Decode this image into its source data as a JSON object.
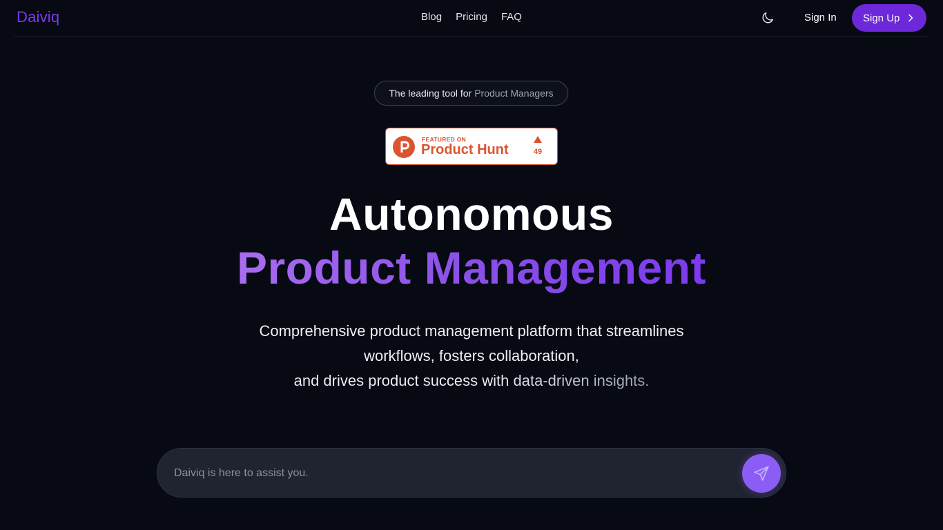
{
  "header": {
    "logo": "Daiviq",
    "nav": [
      "Blog",
      "Pricing",
      "FAQ"
    ],
    "theme_toggle_icon": "moon-icon",
    "sign_in": "Sign In",
    "sign_up": "Sign Up",
    "sign_up_icon": "chevron-right-icon"
  },
  "hero": {
    "pill_text_1": "The leading tool for",
    "pill_text_2": "Product Managers",
    "badge": {
      "featured": "FEATURED ON",
      "name": "Product Hunt",
      "logo_letter": "P",
      "upvotes": "49",
      "brand_color": "#DA552F"
    },
    "title_line1": "Autonomous",
    "title_line2": "Product Management",
    "subtitle_line1": "Comprehensive product management platform that streamlines",
    "subtitle_line2": "workflows, fosters collaboration,",
    "subtitle_line3": "and drives product success with data-driven insights."
  },
  "chat": {
    "placeholder": "Daiviq is here to assist you.",
    "send_icon": "send-icon"
  },
  "colors": {
    "background": "#070913",
    "accent": "#7C3AED",
    "button": "#6D28D9",
    "send_button": "#8B5CF6",
    "input_background": "#1F2430"
  }
}
